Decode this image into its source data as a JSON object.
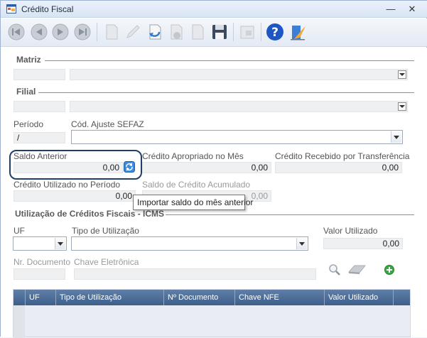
{
  "window": {
    "title": "Crédito Fiscal",
    "minimize_glyph": "—",
    "close_glyph": "✕"
  },
  "toolbar": {
    "buttons": [
      {
        "name": "first-record",
        "icon": "first-icon",
        "enabled": false
      },
      {
        "name": "previous-record",
        "icon": "previous-icon",
        "enabled": false
      },
      {
        "name": "next-record",
        "icon": "next-icon",
        "enabled": false
      },
      {
        "name": "last-record",
        "icon": "last-icon",
        "enabled": false
      },
      {
        "name": "new-record",
        "icon": "new-document-icon",
        "enabled": false
      },
      {
        "name": "edit-record",
        "icon": "pencil-icon",
        "enabled": false
      },
      {
        "name": "undo",
        "icon": "undo-icon",
        "enabled": true
      },
      {
        "name": "delete-record",
        "icon": "delete-icon",
        "enabled": false
      },
      {
        "name": "print",
        "icon": "print-icon",
        "enabled": false
      },
      {
        "name": "save",
        "icon": "save-icon",
        "enabled": true
      },
      {
        "name": "lock",
        "icon": "lock-icon",
        "enabled": false
      },
      {
        "name": "help",
        "icon": "help-icon",
        "enabled": true
      },
      {
        "name": "exit",
        "icon": "exit-door-icon",
        "enabled": true
      }
    ]
  },
  "matriz": {
    "title": "Matriz"
  },
  "filial": {
    "title": "Filial"
  },
  "periodo": {
    "label": "Período",
    "value": "/"
  },
  "ajuste": {
    "label": "Cód. Ajuste SEFAZ",
    "value": ""
  },
  "saldo_anterior": {
    "label": "Saldo Anterior",
    "value": "0,00"
  },
  "credito_apropriado": {
    "label": "Crédito Apropriado no Mês",
    "value": "0,00"
  },
  "credito_recebido": {
    "label": "Crédito Recebido por Transferência",
    "value": "0,00"
  },
  "credito_utilizado": {
    "label": "Crédito Utilizado no Período",
    "value": "0,00"
  },
  "saldo_acumulado": {
    "label": "Saldo de Crédito Acumulado",
    "value": "0,00"
  },
  "tooltip": {
    "text": "Importar saldo do mês anterior"
  },
  "utilizacao": {
    "title": "Utilização de Créditos Fiscais - ICMS",
    "uf_label": "UF",
    "tipo_label": "Tipo de Utilização",
    "valor_label": "Valor Utilizado",
    "valor_value": "0,00",
    "nr_doc_label": "Nr. Documento",
    "chave_label": "Chave Eletrônica"
  },
  "grid": {
    "columns": [
      "UF",
      "Tipo de Utilização",
      "Nº Documento",
      "Chave NFE",
      "Valor Utilizado"
    ],
    "rows": []
  },
  "colors": {
    "highlight_border": "#1f3f67",
    "grid_header": "#4a6a94",
    "field_bg": "#eef0f2"
  }
}
